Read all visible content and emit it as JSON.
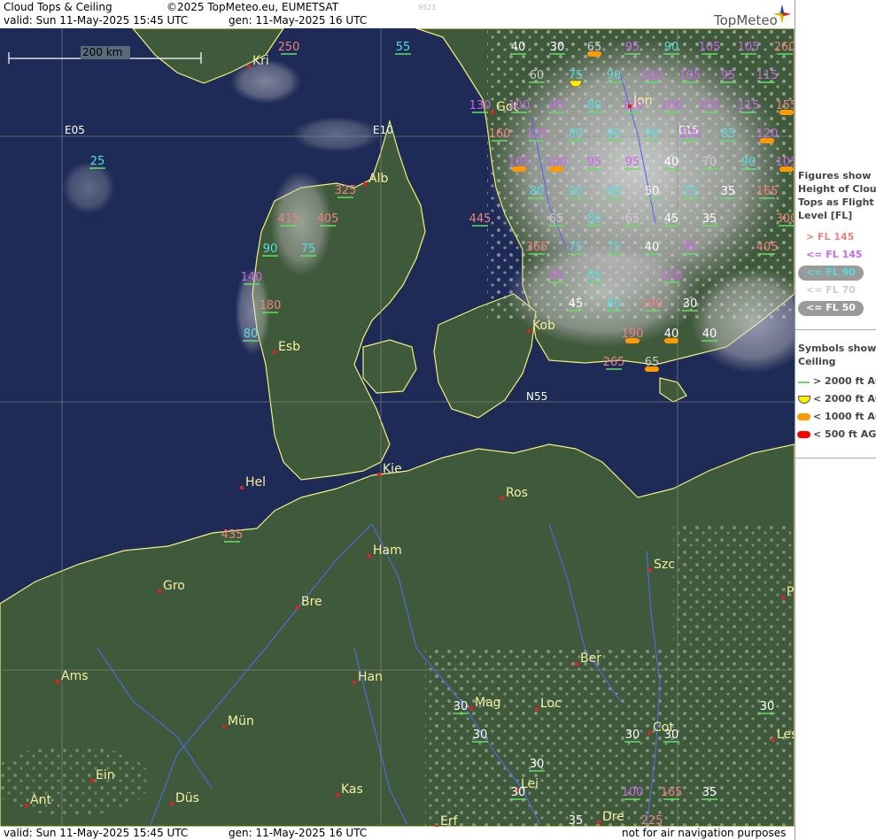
{
  "header": {
    "title": "Cloud Tops & Ceiling",
    "copyright": "©2025 TopMeteo.eu, EUMETSAT",
    "code": "9521",
    "valid": "valid:  Sun  11-May-2025  15:45 UTC",
    "gen": "gen: 11-May-2025 16 UTC",
    "brand": "TopMeteo"
  },
  "footer": {
    "valid": "valid:  Sun  11-May-2025  15:45 UTC",
    "gen": "gen: 11-May-2025 16 UTC",
    "note": "not for air navigation purposes"
  },
  "scale": {
    "label": "200 km"
  },
  "grid_labels": [
    "E05",
    "E10",
    "E15",
    "N55"
  ],
  "cities": [
    "Kri",
    "Got",
    "Jon",
    "Alb",
    "Kob",
    "Esb",
    "Kie",
    "Hel",
    "Ros",
    "Ham",
    "Szc",
    "Gro",
    "Bre",
    "Ber",
    "Ams",
    "Han",
    "Mag",
    "Loc",
    "Mün",
    "Cot",
    "Les",
    "Ein",
    "Kas",
    "Lei",
    "Ant",
    "Düs",
    "Erf",
    "Dre",
    "P"
  ],
  "colors": {
    "above145": "#f08080",
    "le145": "#cc66ee",
    "le90": "#55dddd",
    "le70": "#cccccc",
    "le50": "#ffffff",
    "coast": "#f4f07a",
    "river": "#5566ee",
    "ceil_high": "#66dd66",
    "ceil_2000": "#ffee00",
    "ceil_1000": "#ff9900",
    "ceil_500": "#ff0000"
  },
  "cloud_tops": [
    {
      "value": "250",
      "cat": "above145"
    },
    {
      "value": "55",
      "cat": "le90"
    },
    {
      "value": "40",
      "cat": "le50"
    },
    {
      "value": "30",
      "cat": "le50"
    },
    {
      "value": "65",
      "cat": "le70",
      "ceil": "ceil_1000"
    },
    {
      "value": "95",
      "cat": "le145"
    },
    {
      "value": "90",
      "cat": "le90"
    },
    {
      "value": "105",
      "cat": "le145"
    },
    {
      "value": "105",
      "cat": "le145"
    },
    {
      "value": "260",
      "cat": "above145"
    },
    {
      "value": "60",
      "cat": "le70"
    },
    {
      "value": "75",
      "cat": "le90",
      "ceil": "ceil_2000"
    },
    {
      "value": "90",
      "cat": "le90"
    },
    {
      "value": "100",
      "cat": "le145"
    },
    {
      "value": "105",
      "cat": "le145"
    },
    {
      "value": "95",
      "cat": "le145"
    },
    {
      "value": "115",
      "cat": "le145"
    },
    {
      "value": "130",
      "cat": "le145"
    },
    {
      "value": "100",
      "cat": "le145"
    },
    {
      "value": "95",
      "cat": "le145"
    },
    {
      "value": "80",
      "cat": "le90"
    },
    {
      "value": "110",
      "cat": "le145"
    },
    {
      "value": "100",
      "cat": "le145"
    },
    {
      "value": "105",
      "cat": "le145"
    },
    {
      "value": "115",
      "cat": "le145"
    },
    {
      "value": "155",
      "cat": "above145",
      "ceil": "ceil_1000"
    },
    {
      "value": "160",
      "cat": "above145"
    },
    {
      "value": "125",
      "cat": "le145"
    },
    {
      "value": "80",
      "cat": "le90"
    },
    {
      "value": "90",
      "cat": "le90"
    },
    {
      "value": "90",
      "cat": "le90"
    },
    {
      "value": "100",
      "cat": "le145"
    },
    {
      "value": "85",
      "cat": "le90"
    },
    {
      "value": "120",
      "cat": "le145",
      "ceil": "ceil_1000"
    },
    {
      "value": "25",
      "cat": "le90"
    },
    {
      "value": "105",
      "cat": "le145",
      "ceil": "ceil_1000"
    },
    {
      "value": "100",
      "cat": "le145",
      "ceil": "ceil_1000"
    },
    {
      "value": "95",
      "cat": "le145"
    },
    {
      "value": "95",
      "cat": "le145"
    },
    {
      "value": "40",
      "cat": "le50"
    },
    {
      "value": "70",
      "cat": "le70"
    },
    {
      "value": "90",
      "cat": "le90"
    },
    {
      "value": "105",
      "cat": "le145",
      "ceil": "ceil_1000"
    },
    {
      "value": "80",
      "cat": "le90"
    },
    {
      "value": "90",
      "cat": "le90"
    },
    {
      "value": "90",
      "cat": "le90"
    },
    {
      "value": "50",
      "cat": "le50"
    },
    {
      "value": "75",
      "cat": "le90"
    },
    {
      "value": "35",
      "cat": "le50"
    },
    {
      "value": "165",
      "cat": "above145"
    },
    {
      "value": "325",
      "cat": "above145"
    },
    {
      "value": "445",
      "cat": "above145"
    },
    {
      "value": "65",
      "cat": "le70"
    },
    {
      "value": "85",
      "cat": "le90"
    },
    {
      "value": "65",
      "cat": "le70"
    },
    {
      "value": "45",
      "cat": "le50"
    },
    {
      "value": "35",
      "cat": "le50"
    },
    {
      "value": "300",
      "cat": "above145"
    },
    {
      "value": "415",
      "cat": "above145"
    },
    {
      "value": "405",
      "cat": "above145"
    },
    {
      "value": "90",
      "cat": "le90"
    },
    {
      "value": "75",
      "cat": "le90"
    },
    {
      "value": "365",
      "cat": "above145"
    },
    {
      "value": "75",
      "cat": "le90"
    },
    {
      "value": "75",
      "cat": "le90"
    },
    {
      "value": "40",
      "cat": "le50"
    },
    {
      "value": "95",
      "cat": "le145"
    },
    {
      "value": "405",
      "cat": "above145"
    },
    {
      "value": "140",
      "cat": "le145"
    },
    {
      "value": "95",
      "cat": "le145"
    },
    {
      "value": "85",
      "cat": "le90"
    },
    {
      "value": "110",
      "cat": "le145"
    },
    {
      "value": "180",
      "cat": "above145"
    },
    {
      "value": "45",
      "cat": "le50"
    },
    {
      "value": "80",
      "cat": "le90"
    },
    {
      "value": "190",
      "cat": "above145"
    },
    {
      "value": "30",
      "cat": "le50"
    },
    {
      "value": "80",
      "cat": "le90"
    },
    {
      "value": "190",
      "cat": "above145",
      "ceil": "ceil_1000"
    },
    {
      "value": "40",
      "cat": "le50",
      "ceil": "ceil_1000"
    },
    {
      "value": "40",
      "cat": "le50"
    },
    {
      "value": "265",
      "cat": "above145"
    },
    {
      "value": "65",
      "cat": "le70",
      "ceil": "ceil_1000"
    },
    {
      "value": "435",
      "cat": "above145"
    },
    {
      "value": "30",
      "cat": "le50"
    },
    {
      "value": "30",
      "cat": "le50"
    },
    {
      "value": "30",
      "cat": "le50"
    },
    {
      "value": "30",
      "cat": "le50"
    },
    {
      "value": "30",
      "cat": "le50"
    },
    {
      "value": "30",
      "cat": "le50"
    },
    {
      "value": "30",
      "cat": "le50"
    },
    {
      "value": "100",
      "cat": "le145"
    },
    {
      "value": "165",
      "cat": "above145"
    },
    {
      "value": "35",
      "cat": "le50"
    },
    {
      "value": "35",
      "cat": "le50"
    },
    {
      "value": "225",
      "cat": "above145"
    }
  ],
  "legend": {
    "tops_title": [
      "Figures show",
      "Height of Cloud",
      "Tops as Flight",
      "Level  [FL]"
    ],
    "tops_items": [
      {
        "label": "> FL 145",
        "cat": "above145"
      },
      {
        "label": "<= FL 145",
        "cat": "le145"
      },
      {
        "label": "<= FL 90",
        "cat": "le90"
      },
      {
        "label": "<= FL 70",
        "cat": "le70"
      },
      {
        "label": "<= FL 50",
        "cat": "le50"
      }
    ],
    "ceil_title": [
      "Symbols show",
      "Ceiling"
    ],
    "ceil_items": [
      {
        "label": "> 2000 ft AGL",
        "sym": "ceil_high"
      },
      {
        "label": "< 2000 ft AGL",
        "sym": "ceil_2000"
      },
      {
        "label": "< 1000 ft AGL",
        "sym": "ceil_1000"
      },
      {
        "label": "< 500 ft AGL",
        "sym": "ceil_500"
      }
    ]
  }
}
